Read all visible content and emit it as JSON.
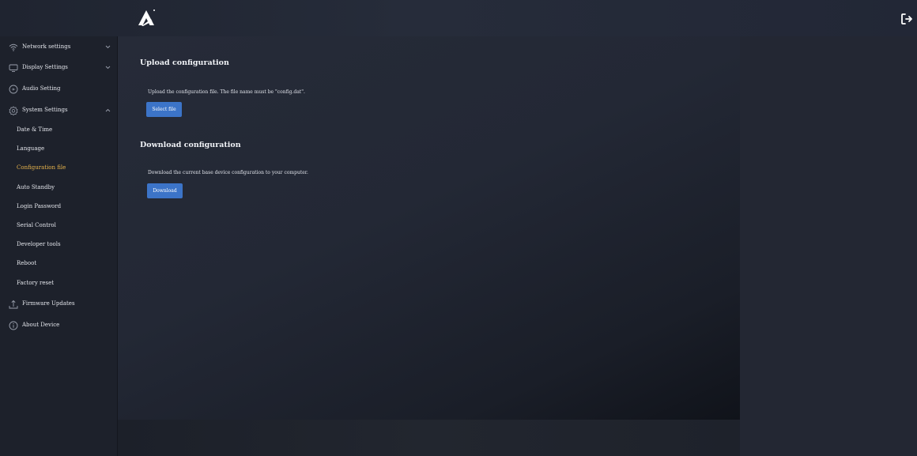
{
  "header": {
    "logo_icon": "triangle-a-logo",
    "logout_icon": "logout-icon"
  },
  "sidebar": {
    "items": [
      {
        "label": "Network settings",
        "icon": "wifi-icon",
        "expand": "chevron-down"
      },
      {
        "label": "Display Settings",
        "icon": "monitor-icon",
        "expand": "chevron-down"
      },
      {
        "label": "Audio Setting",
        "icon": "audio-icon"
      },
      {
        "label": "System Settings",
        "icon": "gear-icon",
        "expand": "chevron-up"
      },
      {
        "label": "Firmware Updates",
        "icon": "upload-icon"
      },
      {
        "label": "About Device",
        "icon": "info-icon"
      }
    ],
    "system_sub_items": [
      {
        "label": "Date & Time"
      },
      {
        "label": "Language"
      },
      {
        "label": "Configuration file",
        "active": true
      },
      {
        "label": "Auto Standby"
      },
      {
        "label": "Login Password"
      },
      {
        "label": "Serial Control"
      },
      {
        "label": "Developer tools"
      },
      {
        "label": "Reboot"
      },
      {
        "label": "Factory reset"
      }
    ],
    "active_color": "#e8b44c"
  },
  "main": {
    "upload": {
      "title": "Upload configuration",
      "description": "Upload the configuration file. The file name must be \"config.dat\".",
      "button_label": "Select file"
    },
    "download": {
      "title": "Download configuration",
      "description": "Download the current base device configuration to your computer.",
      "button_label": "Download"
    },
    "button_color": "#3c74c8"
  }
}
